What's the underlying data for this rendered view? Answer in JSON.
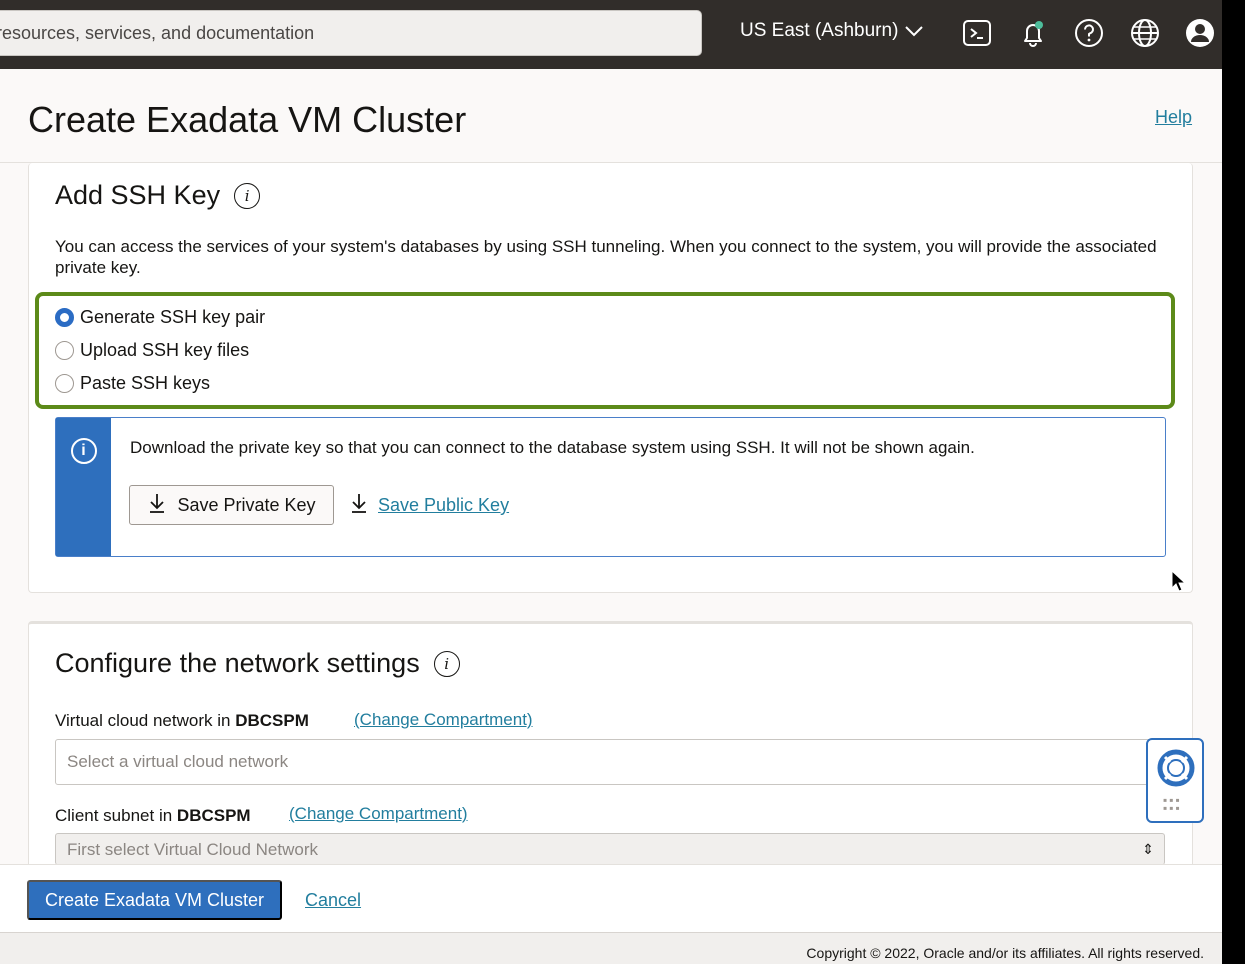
{
  "header": {
    "search_placeholder": "resources, services, and documentation",
    "region": "US East (Ashburn)",
    "icons": [
      "cloud-shell-icon",
      "bell-icon",
      "help-icon",
      "globe-icon",
      "user-icon"
    ]
  },
  "page": {
    "title": "Create Exadata VM Cluster",
    "help_label": "Help"
  },
  "ssh_section": {
    "title": "Add SSH Key",
    "description": "You can access the services of your system's databases by using SSH tunneling. When you connect to the system, you will provide the associated private key.",
    "options": [
      {
        "label": "Generate SSH key pair",
        "selected": true
      },
      {
        "label": "Upload SSH key files",
        "selected": false
      },
      {
        "label": "Paste SSH keys",
        "selected": false
      }
    ],
    "info_text": "Download the private key so that you can connect to the database system using SSH. It will not be shown again.",
    "save_private_label": "Save Private Key",
    "save_public_label": "Save Public Key"
  },
  "network_section": {
    "title": "Configure the network settings",
    "vcn_label_prefix": "Virtual cloud network in",
    "vcn_compartment": "DBCSPM",
    "vcn_change": "(Change Compartment)",
    "vcn_placeholder": "Select a virtual cloud network",
    "subnet_label_prefix": "Client subnet in",
    "subnet_compartment": "DBCSPM",
    "subnet_change": "(Change Compartment)",
    "subnet_placeholder": "First select Virtual Cloud Network"
  },
  "footer": {
    "create_label": "Create Exadata VM Cluster",
    "cancel_label": "Cancel",
    "copyright": "Copyright © 2022, Oracle and/or its affiliates. All rights reserved."
  },
  "colors": {
    "header_bg": "#312d2a",
    "primary": "#2e6fbd",
    "link": "#227e9e",
    "highlight": "#5c8a19"
  }
}
